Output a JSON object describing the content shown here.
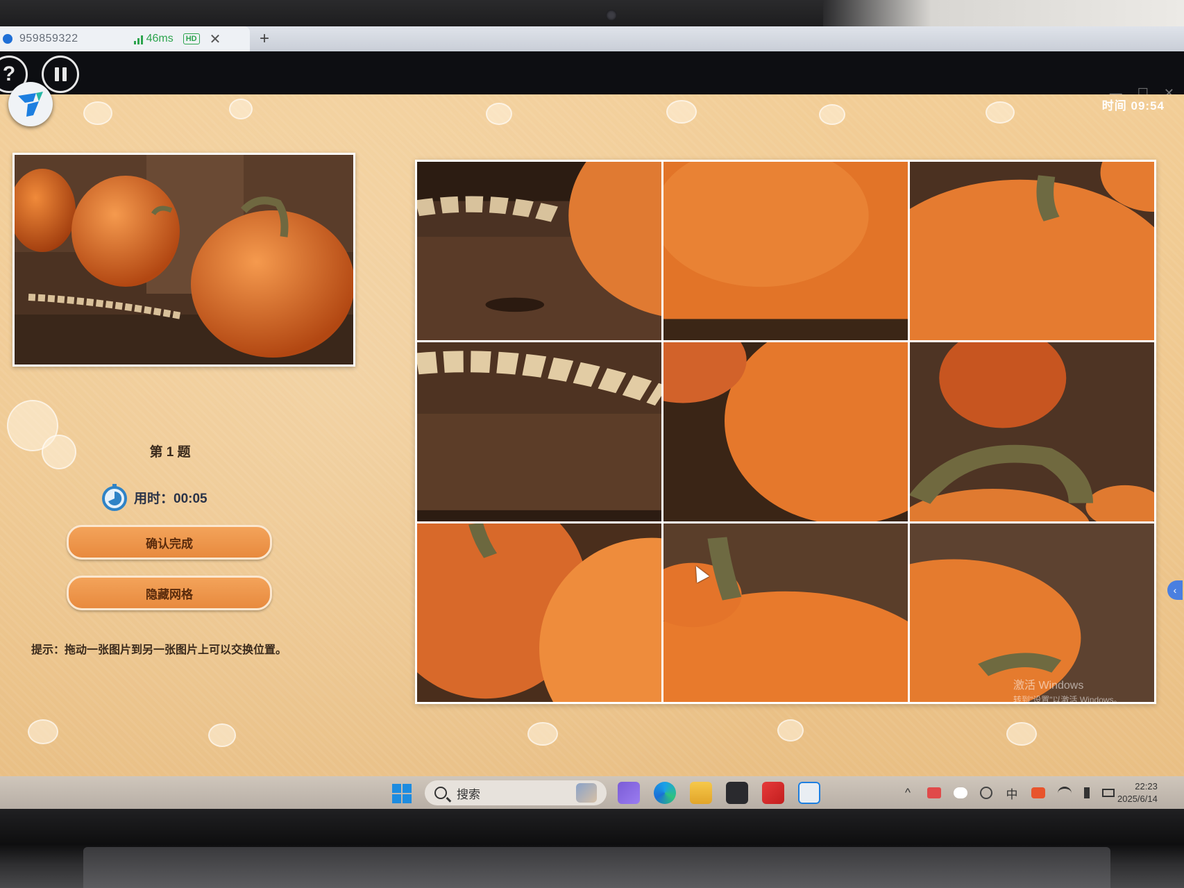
{
  "browser": {
    "tab_title": "959859322",
    "ping": "46ms",
    "hd_badge": "HD",
    "close_glyph": "✕",
    "add_glyph": "+"
  },
  "app": {
    "help_glyph": "?",
    "window_controls": [
      "—",
      "☐",
      "✕"
    ],
    "timer_label": "时间  09:54"
  },
  "panel": {
    "question": "第 1 题",
    "elapsed": "用时：00:05",
    "confirm_button": "确认完成",
    "hide_grid_button": "隐藏网格",
    "hint": "提示：拖动一张图片到另一张图片上可以交换位置。"
  },
  "board": {
    "rows": 3,
    "cols": 3,
    "handle_glyph": "‹"
  },
  "watermark": {
    "line1": "激活 Windows",
    "line2": "转到\"设置\"以激活 Windows。"
  },
  "taskbar": {
    "search_placeholder": "搜索",
    "tray_caret": "^",
    "ime": "中",
    "time": "22:23",
    "date": "2025/6/14"
  },
  "colors": {
    "accent_button": "#ec8f42",
    "board_border": "#ffffff",
    "signal_green": "#2da44e"
  }
}
